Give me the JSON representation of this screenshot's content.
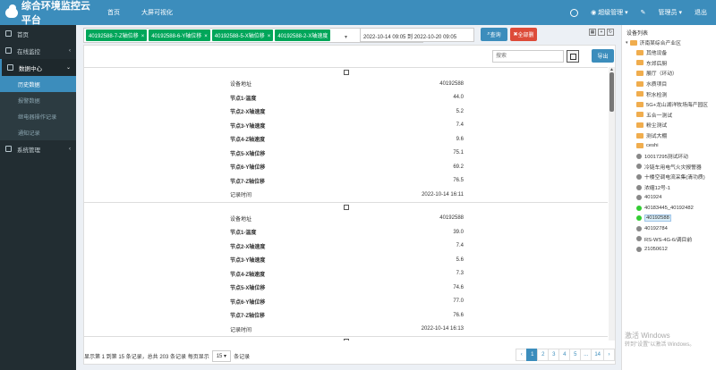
{
  "header": {
    "title": "综合环境监控云平台",
    "nav": [
      "首页",
      "大屏可视化"
    ],
    "user_menu": "超级管理",
    "admin_menu": "管理员",
    "logout": "退出"
  },
  "sidebar": {
    "items": [
      {
        "label": "首页"
      },
      {
        "label": "在线监控"
      },
      {
        "label": "数据中心"
      }
    ],
    "subitems": [
      "历史数据",
      "报警数据",
      "继电器操作记录",
      "通知记录"
    ],
    "system": "系统管理"
  },
  "filters": {
    "tags": [
      "40192588-7-Z轴位移",
      "40192588-6-Y轴位移",
      "40192588-5-X轴位移",
      "40192588-2-X轴速度"
    ],
    "date_range": "2022-10-14 09:05 到 2022-10-20 09:05",
    "query": "查询",
    "delete": "全部删"
  },
  "toolbar": {
    "search_placeholder": "搜索",
    "export": "导出"
  },
  "records": [
    {
      "rows": [
        {
          "k": "设备地址",
          "v": "40192588",
          "bold": false
        },
        {
          "k": "节点1-温度",
          "v": "44.0",
          "bold": true
        },
        {
          "k": "节点2-X轴速度",
          "v": "5.2",
          "bold": true
        },
        {
          "k": "节点3-Y轴速度",
          "v": "7.4",
          "bold": true
        },
        {
          "k": "节点4-Z轴速度",
          "v": "9.6",
          "bold": true
        },
        {
          "k": "节点5-X轴位移",
          "v": "75.1",
          "bold": true
        },
        {
          "k": "节点6-Y轴位移",
          "v": "69.2",
          "bold": true
        },
        {
          "k": "节点7-Z轴位移",
          "v": "76.5",
          "bold": true
        },
        {
          "k": "记录时间",
          "v": "2022-10-14 16:11",
          "bold": false
        }
      ]
    },
    {
      "rows": [
        {
          "k": "设备地址",
          "v": "40192588",
          "bold": false
        },
        {
          "k": "节点1-温度",
          "v": "39.0",
          "bold": true
        },
        {
          "k": "节点2-X轴速度",
          "v": "7.4",
          "bold": true
        },
        {
          "k": "节点3-Y轴速度",
          "v": "5.6",
          "bold": true
        },
        {
          "k": "节点4-Z轴速度",
          "v": "7.3",
          "bold": true
        },
        {
          "k": "节点5-X轴位移",
          "v": "74.6",
          "bold": true
        },
        {
          "k": "节点6-Y轴位移",
          "v": "77.0",
          "bold": true
        },
        {
          "k": "节点7-Z轴位移",
          "v": "76.6",
          "bold": true
        },
        {
          "k": "记录时间",
          "v": "2022-10-14 16:13",
          "bold": false
        }
      ]
    }
  ],
  "footer": {
    "info_prefix": "显示第 1 到第 15 条记录，总共 203 条记录 每页显示",
    "page_size": "15 ▾",
    "info_suffix": "条记录",
    "pages": [
      "‹",
      "1",
      "2",
      "3",
      "4",
      "5",
      "...",
      "14",
      "›"
    ],
    "active_page": "1"
  },
  "tree": {
    "title": "设备列表",
    "root": "济南某综合产业区",
    "nodes": [
      {
        "label": "其他设备",
        "type": "folder"
      },
      {
        "label": "东郊后厨",
        "type": "folder"
      },
      {
        "label": "展厅（环动）",
        "type": "folder"
      },
      {
        "label": "水质项目",
        "type": "folder"
      },
      {
        "label": "积水检测",
        "type": "folder"
      },
      {
        "label": "5G+龙山湖洋牧场海产园区",
        "type": "folder"
      },
      {
        "label": "五合一测试",
        "type": "folder"
      },
      {
        "label": "粉尘测试",
        "type": "folder"
      },
      {
        "label": "测试大棚",
        "type": "folder"
      },
      {
        "label": "ceshi",
        "type": "folder"
      },
      {
        "label": "10017295测试环动",
        "type": "device"
      },
      {
        "label": "冷链车用电气火灾报警器",
        "type": "device"
      },
      {
        "label": "十楼空调电流采集(清功质)",
        "type": "device"
      },
      {
        "label": "浓缩12号-1",
        "type": "device"
      },
      {
        "label": "401924",
        "type": "device"
      },
      {
        "label": "40183445_40192482",
        "type": "device-green"
      },
      {
        "label": "40192588",
        "type": "device-green-selected"
      },
      {
        "label": "40192784",
        "type": "device"
      },
      {
        "label": "RS-WS-4G-6/调目前",
        "type": "device"
      },
      {
        "label": "21050612",
        "type": "device"
      }
    ],
    "watermark_line1": "激活 Windows",
    "watermark_line2": "转到\"设置\"以激活 Windows。"
  }
}
